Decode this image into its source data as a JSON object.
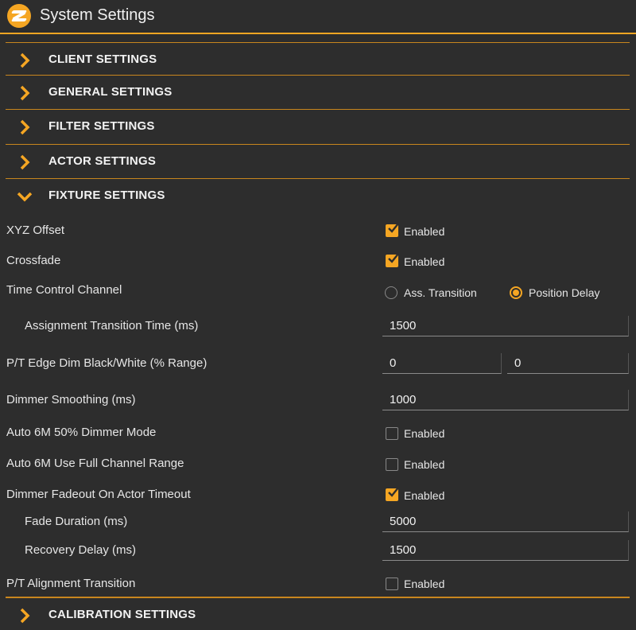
{
  "app": {
    "title": "System Settings",
    "accent_color": "#f5a623",
    "logo_icon": "app-logo-icon"
  },
  "sections": {
    "client": "CLIENT SETTINGS",
    "general": "GENERAL SETTINGS",
    "filter": "FILTER SETTINGS",
    "actor": "ACTOR SETTINGS",
    "fixture": "FIXTURE SETTINGS",
    "calibration": "CALIBRATION SETTINGS"
  },
  "fixture": {
    "xyz_offset": {
      "label": "XYZ Offset",
      "option": "Enabled",
      "checked": true
    },
    "crossfade": {
      "label": "Crossfade",
      "option": "Enabled",
      "checked": true
    },
    "time_control_channel": {
      "label": "Time Control Channel",
      "options": [
        "Ass. Transition",
        "Position Delay"
      ],
      "selected": "Position Delay"
    },
    "assignment_transition_time": {
      "label": "Assignment Transition Time (ms)",
      "value": "1500"
    },
    "pt_edge_dim": {
      "label": "P/T Edge Dim Black/White (% Range)",
      "value_black": "0",
      "value_white": "0"
    },
    "dimmer_smoothing": {
      "label": "Dimmer Smoothing (ms)",
      "value": "1000"
    },
    "auto_6m_50_dimmer": {
      "label": "Auto 6M 50% Dimmer Mode",
      "option": "Enabled",
      "checked": false
    },
    "auto_6m_full_range": {
      "label": "Auto 6M Use Full Channel Range",
      "option": "Enabled",
      "checked": false
    },
    "dimmer_fadeout": {
      "label": "Dimmer Fadeout On Actor Timeout",
      "option": "Enabled",
      "checked": true
    },
    "fade_duration": {
      "label": "Fade Duration (ms)",
      "value": "5000"
    },
    "recovery_delay": {
      "label": "Recovery Delay (ms)",
      "value": "1500"
    },
    "pt_alignment_transition": {
      "label": "P/T Alignment Transition",
      "option": "Enabled",
      "checked": false
    }
  }
}
